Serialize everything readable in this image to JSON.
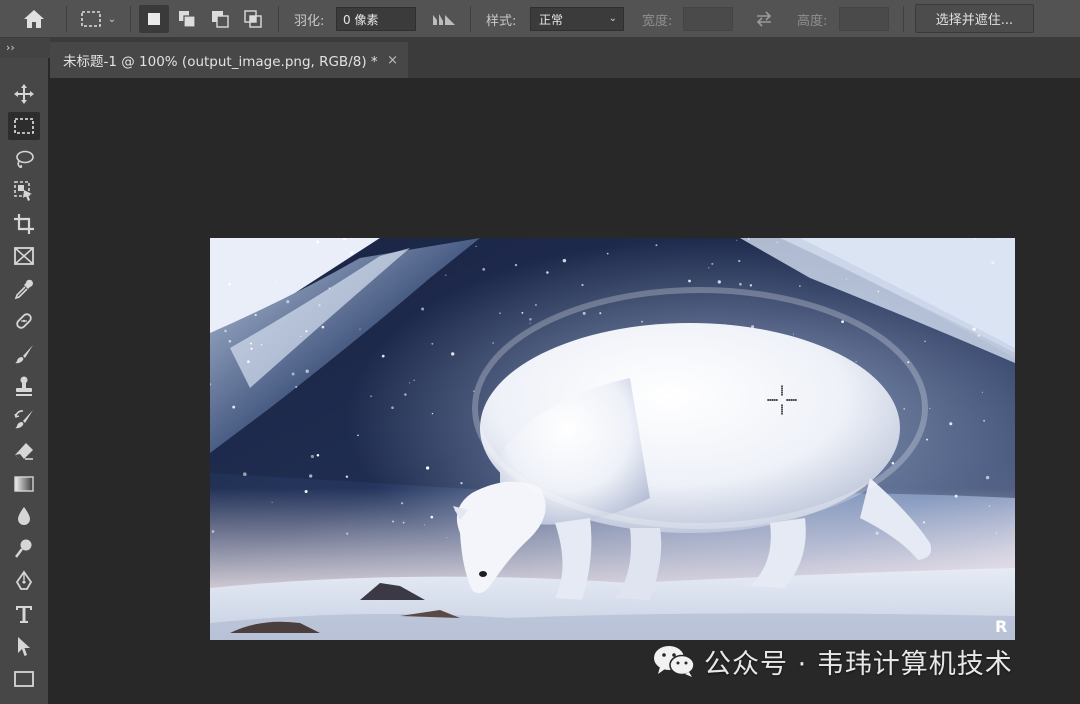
{
  "options_bar": {
    "feather_label": "羽化:",
    "feather_value": "0 像素",
    "style_label": "样式:",
    "style_value": "正常",
    "width_label": "宽度:",
    "width_value": "",
    "height_label": "高度:",
    "height_value": "",
    "select_mask_label": "选择并遮住..."
  },
  "document_tab": {
    "title": "未标题-1 @ 100% (output_image.png, RGB/8) *",
    "close_glyph": "×"
  },
  "panel_collapse_glyph": "››",
  "tools": [
    {
      "name": "move-tool",
      "icon": "move-icon"
    },
    {
      "name": "rectangular-marquee-tool",
      "icon": "marquee-icon",
      "active": true
    },
    {
      "name": "lasso-tool",
      "icon": "lasso-icon"
    },
    {
      "name": "object-selection-tool",
      "icon": "object-selection-icon"
    },
    {
      "name": "crop-tool",
      "icon": "crop-icon"
    },
    {
      "name": "frame-tool",
      "icon": "frame-icon"
    },
    {
      "name": "eyedropper-tool",
      "icon": "eyedropper-icon"
    },
    {
      "name": "healing-brush-tool",
      "icon": "bandage-icon"
    },
    {
      "name": "brush-tool",
      "icon": "brush-icon"
    },
    {
      "name": "clone-stamp-tool",
      "icon": "stamp-icon"
    },
    {
      "name": "history-brush-tool",
      "icon": "history-brush-icon"
    },
    {
      "name": "eraser-tool",
      "icon": "eraser-icon"
    },
    {
      "name": "gradient-tool",
      "icon": "gradient-icon"
    },
    {
      "name": "blur-tool",
      "icon": "drop-icon"
    },
    {
      "name": "dodge-tool",
      "icon": "dodge-icon"
    },
    {
      "name": "pen-tool",
      "icon": "pen-icon"
    },
    {
      "name": "type-tool",
      "icon": "type-icon"
    },
    {
      "name": "path-selection-tool",
      "icon": "arrow-icon"
    },
    {
      "name": "rectangle-tool",
      "icon": "rectangle-icon"
    }
  ],
  "watermark": {
    "text": "公众号 · 韦玮计算机技术",
    "icon": "wechat-icon"
  },
  "colors": {
    "options_bar": "#535353",
    "toolbar": "#474747",
    "canvas": "#282828",
    "tab_active": "#474747"
  }
}
